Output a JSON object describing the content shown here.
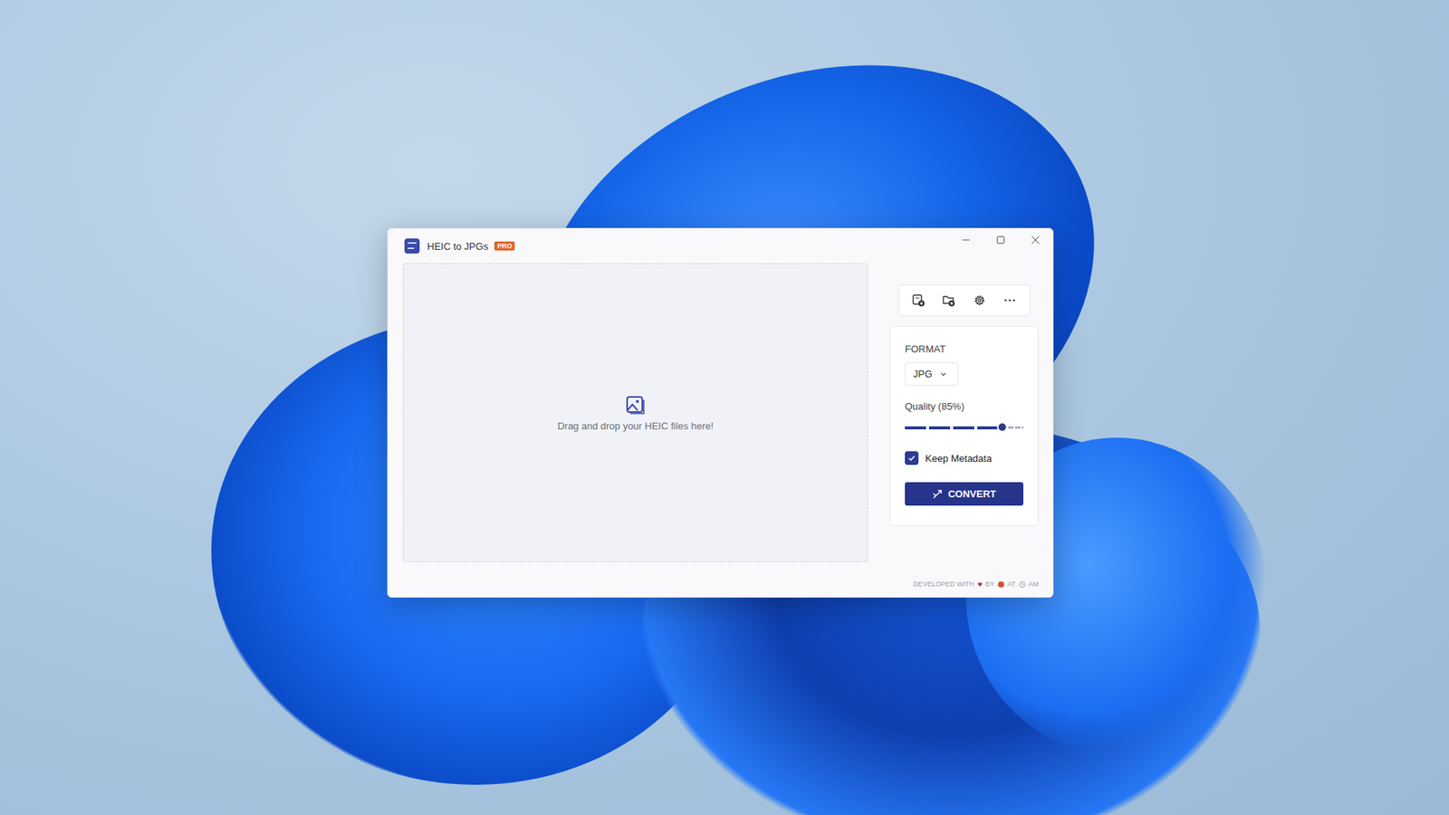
{
  "window": {
    "title": "HEIC to JPGs",
    "badge": "PRO"
  },
  "dropzone": {
    "text": "Drag and drop your HEIC files here!"
  },
  "settings": {
    "format_label": "FORMAT",
    "format": "JPG",
    "quality_label": "Quality (85%)",
    "quality_level": 0.82,
    "keep_metadata": {
      "label": "Keep Metadata",
      "checked": true
    },
    "convert_button": "CONVERT"
  },
  "footer": {
    "developed": "DEVELOPED WITH",
    "by": "BY",
    "at": "AT",
    "time": "AM"
  }
}
